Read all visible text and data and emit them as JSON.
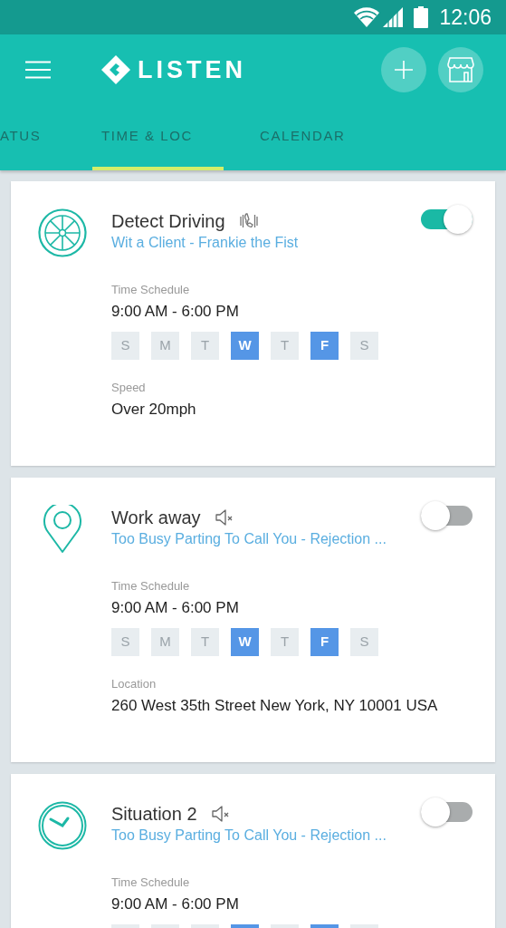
{
  "status_bar": {
    "time": "12:06"
  },
  "app_bar": {
    "title": "LISTEN"
  },
  "tabs": [
    {
      "label": "ATUS",
      "selected": false
    },
    {
      "label": "TIME & LOC",
      "selected": true
    },
    {
      "label": "CALENDAR",
      "selected": false
    }
  ],
  "cards": [
    {
      "kind": "wheel",
      "title": "Detect Driving",
      "alert": {
        "kind": "vibrate"
      },
      "subtitle": "Wit a Client - Frankie the Fist",
      "on": true,
      "schedule_label": "Time Schedule",
      "schedule": "9:00 AM - 6:00 PM",
      "days": [
        {
          "label": "S",
          "selected": false
        },
        {
          "label": "M",
          "selected": false
        },
        {
          "label": "T",
          "selected": false
        },
        {
          "label": "W",
          "selected": true
        },
        {
          "label": "T",
          "selected": false
        },
        {
          "label": "F",
          "selected": true
        },
        {
          "label": "S",
          "selected": false
        }
      ],
      "detail_label": "Speed",
      "detail": "Over 20mph"
    },
    {
      "kind": "pin",
      "title": "Work away",
      "alert": {
        "kind": "mute"
      },
      "subtitle": "Too Busy Parting To Call You - Rejection ...",
      "on": false,
      "schedule_label": "Time Schedule",
      "schedule": "9:00 AM - 6:00 PM",
      "days": [
        {
          "label": "S",
          "selected": false
        },
        {
          "label": "M",
          "selected": false
        },
        {
          "label": "T",
          "selected": false
        },
        {
          "label": "W",
          "selected": true
        },
        {
          "label": "T",
          "selected": false
        },
        {
          "label": "F",
          "selected": true
        },
        {
          "label": "S",
          "selected": false
        }
      ],
      "detail_label": "Location",
      "detail": "260 West 35th Street New York, NY 10001 USA"
    },
    {
      "kind": "clock",
      "title": "Situation 2",
      "alert": {
        "kind": "mute"
      },
      "subtitle": "Too Busy Parting To Call You - Rejection ...",
      "on": false,
      "schedule_label": "Time Schedule",
      "schedule": "9:00 AM - 6:00 PM",
      "days": [
        {
          "selected": false
        },
        {
          "selected": false
        },
        {
          "selected": false
        },
        {
          "selected": true
        },
        {
          "selected": false
        },
        {
          "selected": true
        },
        {
          "selected": false
        }
      ]
    }
  ]
}
